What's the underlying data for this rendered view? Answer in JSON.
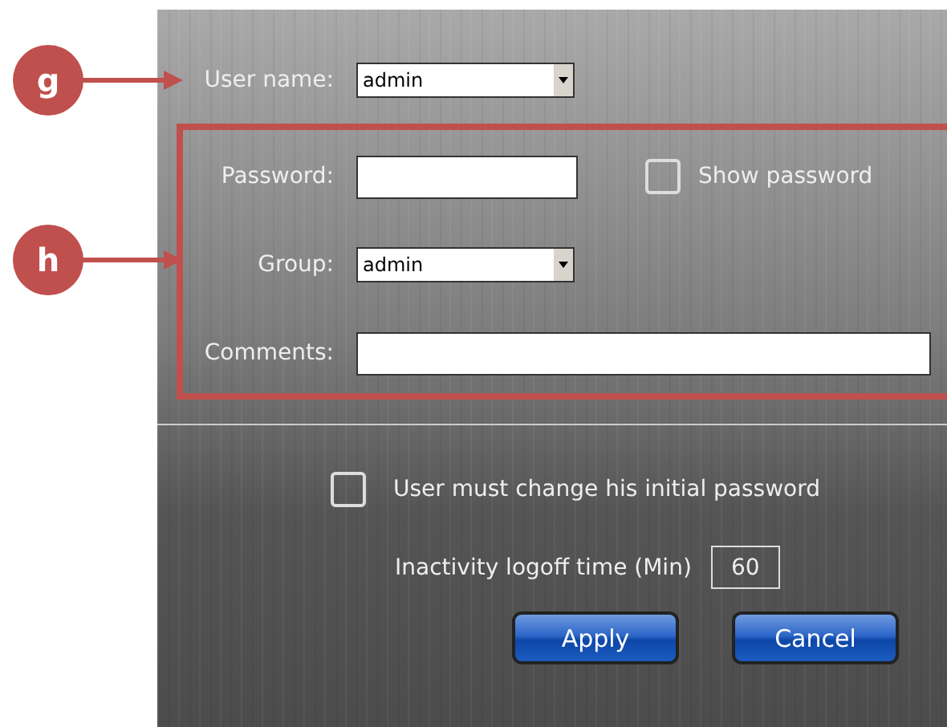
{
  "callouts": [
    {
      "letter": "g"
    },
    {
      "letter": "h"
    }
  ],
  "user_name": {
    "label": "User name:",
    "value": "admin"
  },
  "password": {
    "label": "Password:"
  },
  "show_password": {
    "label": "Show password",
    "checked": false
  },
  "group": {
    "label": "Group:",
    "value": "admin"
  },
  "comments": {
    "label": "Comments:"
  },
  "must_change": {
    "label": "User must change his initial password",
    "checked": false
  },
  "inactivity": {
    "label": "Inactivity logoff time  (Min)",
    "value": "60"
  },
  "buttons": [
    "Apply",
    "Cancel"
  ]
}
